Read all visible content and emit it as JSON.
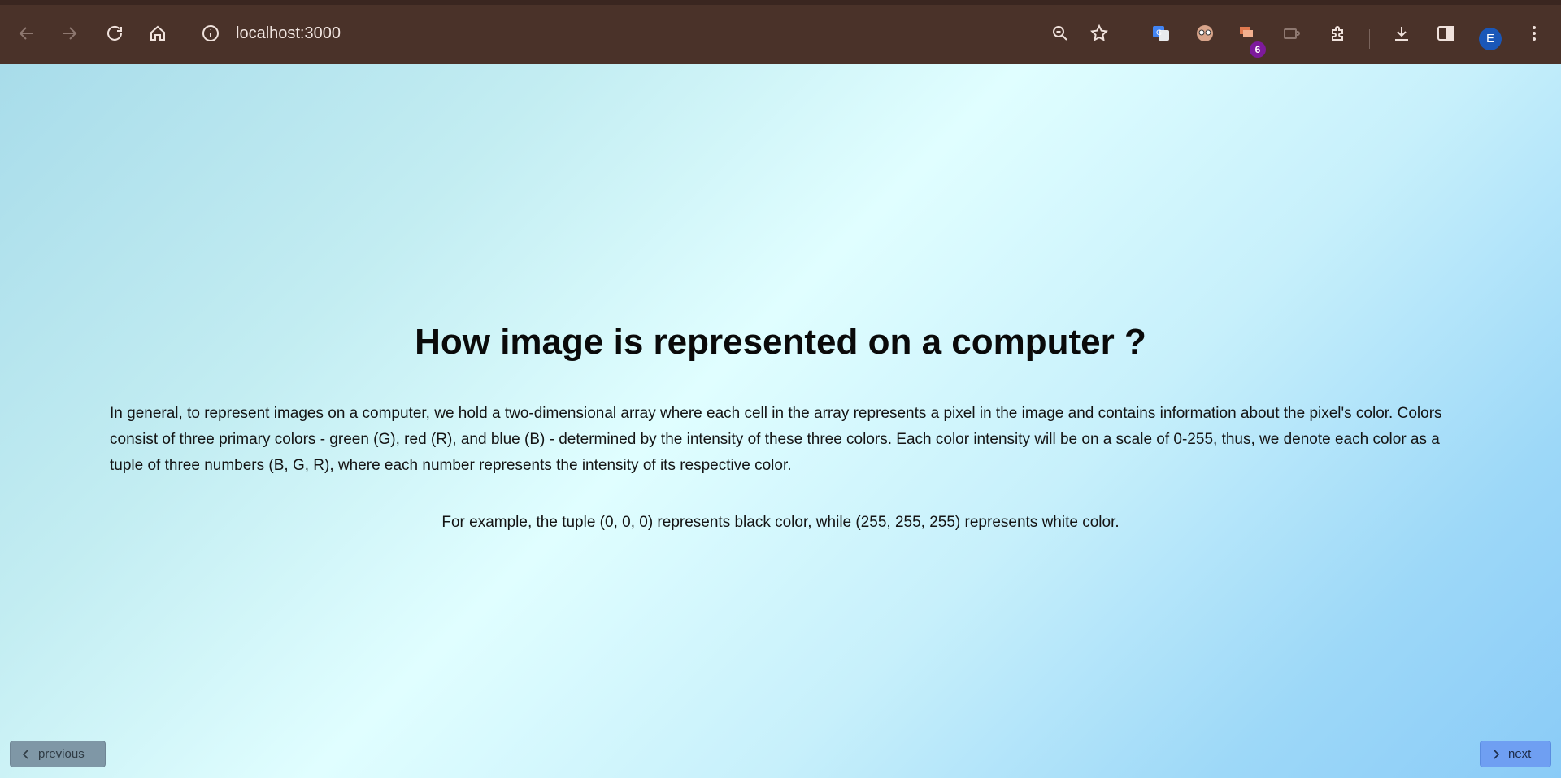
{
  "browser": {
    "url": "localhost:3000",
    "extension_badge": "6",
    "profile_initial": "E"
  },
  "content": {
    "title": "How image is represented on a computer ?",
    "paragraph": "In general, to represent images on a computer, we hold a two-dimensional array where each cell in the array represents a pixel in the image and contains information about the pixel's color. Colors consist of three primary colors - green (G), red (R), and blue (B) - determined by the intensity of these three colors. Each color intensity will be on a scale of 0-255, thus, we denote each color as a tuple of three numbers (B, G, R), where each number represents the intensity of its respective color.",
    "example": "For example, the tuple (0, 0, 0) represents black color, while (255, 255, 255) represents white color."
  },
  "navigation": {
    "previous_label": "previous",
    "next_label": "next"
  },
  "colors": {
    "toolbar": "#4a3229",
    "previous_button": "#7f97a6",
    "next_button": "#6f9ff2",
    "avatar": "#1a57b8",
    "badge": "#7d1a9c"
  }
}
